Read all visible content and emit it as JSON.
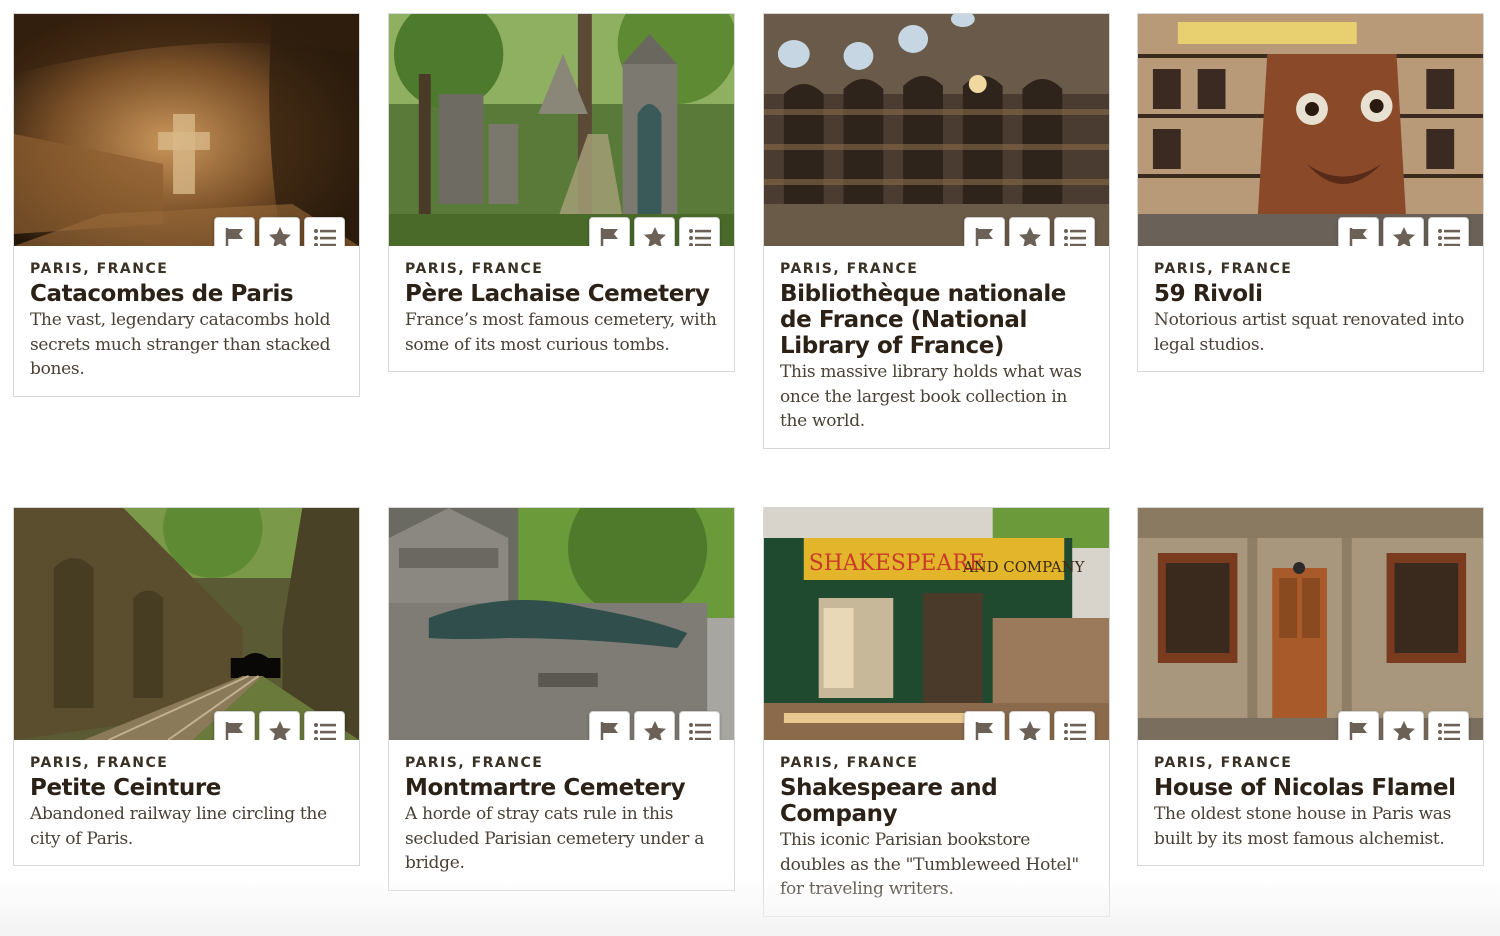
{
  "cards": [
    {
      "location": "PARIS, FRANCE",
      "title": "Catacombes de Paris",
      "description": "The vast, legendary catacombs hold secrets much stranger than stacked bones.",
      "image": "catacomb-bones-photo",
      "colors": [
        "#5a3a1c",
        "#a87a46",
        "#2a1a0c"
      ]
    },
    {
      "location": "PARIS, FRANCE",
      "title": "Père Lachaise Cemetery",
      "description": "France’s most famous cemetery, with some of its most curious tombs.",
      "image": "cemetery-tombs-photo",
      "colors": [
        "#3f5a2a",
        "#8ea06a",
        "#6d6c64"
      ]
    },
    {
      "location": "PARIS, FRANCE",
      "title": "Bibliothèque nationale de France (National Library of France)",
      "description": "This massive library holds what was once the largest book collection in the world.",
      "image": "library-reading-room-photo",
      "colors": [
        "#3b2e24",
        "#8a7458",
        "#b7c6cf"
      ]
    },
    {
      "location": "PARIS, FRANCE",
      "title": "59 Rivoli",
      "description": "Notorious artist squat renovated into legal studios.",
      "image": "art-building-facade-photo",
      "colors": [
        "#7a4a30",
        "#c6a88a",
        "#3a2418"
      ]
    },
    {
      "location": "PARIS, FRANCE",
      "title": "Petite Ceinture",
      "description": "Abandoned railway line circling the city of Paris.",
      "image": "railway-tunnel-photo",
      "colors": [
        "#4d4a2a",
        "#8b8a5a",
        "#2a2418"
      ]
    },
    {
      "location": "PARIS, FRANCE",
      "title": "Montmartre Cemetery",
      "description": "A horde of stray cats rule in this secluded Parisian cemetery under a bridge.",
      "image": "montmartre-tomb-photo",
      "colors": [
        "#6a6a62",
        "#4f7a3a",
        "#2f4a48"
      ]
    },
    {
      "location": "PARIS, FRANCE",
      "title": "Shakespeare and Company",
      "description": "This iconic Parisian bookstore doubles as the \"Tumbleweed Hotel\" for traveling writers.",
      "image": "bookstore-storefront-photo",
      "colors": [
        "#1e4a30",
        "#e2b52a",
        "#c93a2a"
      ]
    },
    {
      "location": "PARIS, FRANCE",
      "title": "House of Nicolas Flamel",
      "description": "The oldest stone house in Paris was built by its most famous alchemist.",
      "image": "stone-house-photo",
      "colors": [
        "#9a8a72",
        "#7a3a1e",
        "#5a4a38"
      ]
    }
  ],
  "actions": {
    "been_here": "flag-icon",
    "favorite": "star-icon",
    "add_to_list": "list-icon"
  },
  "icon_color": "#6b6157"
}
